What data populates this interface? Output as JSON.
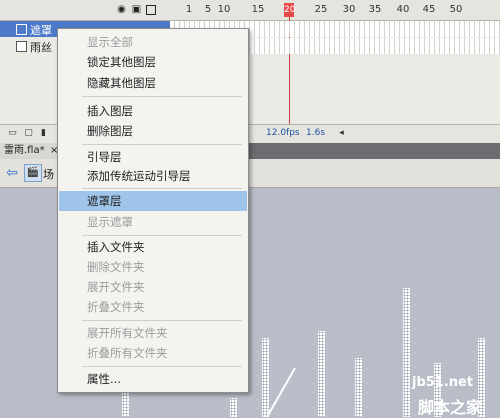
{
  "timeline": {
    "header_icons": [
      "eye-icon",
      "lock-icon",
      "outline-icon"
    ],
    "frame_numbers": [
      "1",
      "5",
      "10",
      "15",
      "20",
      "25",
      "30",
      "35",
      "40",
      "45",
      "50"
    ],
    "playhead_frame": "20",
    "layers": [
      {
        "name": "遮罩"
      },
      {
        "name": "雨丝"
      }
    ],
    "footer": {
      "fps": "12.0fps",
      "time": "1.6s"
    }
  },
  "document_tab": {
    "name": "雷雨.fla*",
    "close": "×"
  },
  "edit_bar": {
    "scene_label": "场"
  },
  "context_menu": {
    "items": [
      {
        "label": "显示全部",
        "disabled": true
      },
      {
        "label": "锁定其他图层",
        "disabled": false
      },
      {
        "label": "隐藏其他图层",
        "disabled": false
      },
      {
        "label": "插入图层",
        "disabled": false
      },
      {
        "label": "删除图层",
        "disabled": false
      },
      {
        "label": "引导层",
        "disabled": false
      },
      {
        "label": "添加传统运动引导层",
        "disabled": false
      },
      {
        "label": "遮罩层",
        "disabled": false,
        "highlighted": true
      },
      {
        "label": "显示遮罩",
        "disabled": true
      },
      {
        "label": "插入文件夹",
        "disabled": false
      },
      {
        "label": "删除文件夹",
        "disabled": true
      },
      {
        "label": "展开文件夹",
        "disabled": true
      },
      {
        "label": "折叠文件夹",
        "disabled": true
      },
      {
        "label": "展开所有文件夹",
        "disabled": true
      },
      {
        "label": "折叠所有文件夹",
        "disabled": true
      },
      {
        "label": "属性...",
        "disabled": false
      }
    ]
  },
  "watermark": {
    "url": "jb51.net",
    "name": "脚本之家"
  },
  "colors": {
    "highlight": "#9ec4ea",
    "layer_selected": "#4d79c9",
    "playhead": "#e84a4a",
    "stage": "#b9bdc8"
  }
}
